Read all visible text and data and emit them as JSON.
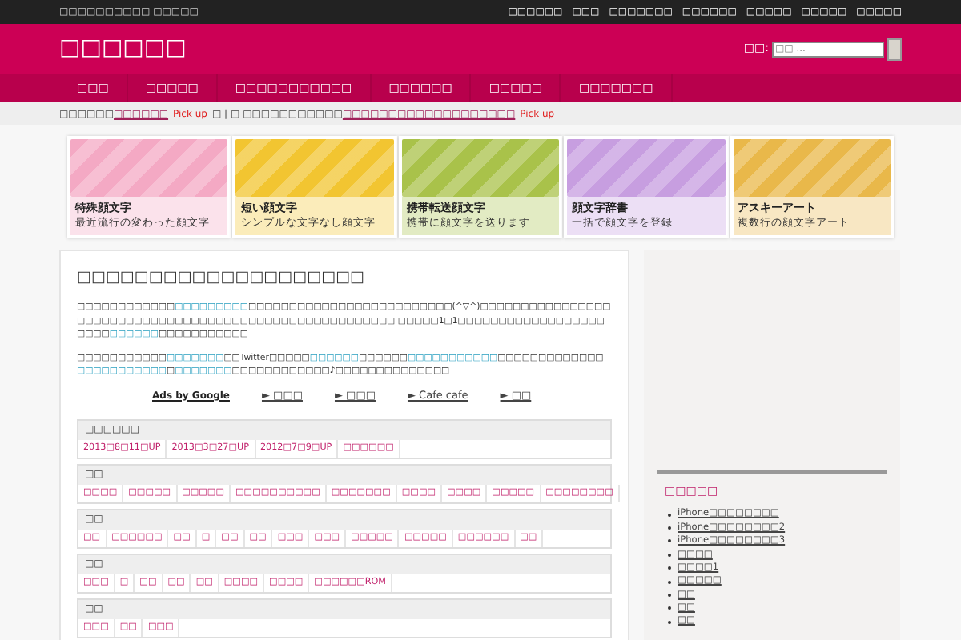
{
  "top_bar": {
    "tagline": "□□□□□□□□□□ □□□□□",
    "links": [
      "□□□□□□",
      "□□□",
      "□□□□□□□",
      "□□□□□□",
      "□□□□□",
      "□□□□□",
      "□□□□□"
    ]
  },
  "header": {
    "title": "□□□□□□",
    "search_label": "□□:",
    "search_placeholder": "□□ ..."
  },
  "nav": [
    "□□□",
    "□□□□□",
    "□□□□□□□□□□□",
    "□□□□□□",
    "□□□□□",
    "□□□□□□□"
  ],
  "pickup": [
    {
      "kind": "plain",
      "text": "□□□□□□"
    },
    {
      "kind": "link",
      "text": "□□□□□□"
    },
    {
      "kind": "pick",
      "text": "Pick up"
    },
    {
      "kind": "plain",
      "text": "□ | □ □□□□□□□□□□□"
    },
    {
      "kind": "link",
      "text": "□□□□□□□□□□□□□□□□□□□"
    },
    {
      "kind": "pick",
      "text": "Pick up"
    }
  ],
  "banners": [
    {
      "title": "特殊顔文字",
      "subtitle": "最近流行の変わった顔文字",
      "color": "#f4a9c4"
    },
    {
      "title": "短い顔文字",
      "subtitle": "シンプルな文字なし顔文字",
      "color": "#f2c531"
    },
    {
      "title": "携帯転送顔文字",
      "subtitle": "携帯に顔文字を送ります",
      "color": "#a9c24a"
    },
    {
      "title": "顔文字辞書",
      "subtitle": "一括で顔文字を登録",
      "color": "#c79ee0"
    },
    {
      "title": "アスキーアート",
      "subtitle": "複数行の顔文字アート",
      "color": "#e9b84a"
    }
  ],
  "article": {
    "title": "□□□□□□□□□□□□□□□□□□□□",
    "paragraphs": [
      [
        {
          "text": "□□□□□□□□□□□□",
          "link": false
        },
        {
          "text": "□□□□□□□□□",
          "link": true
        },
        {
          "text": "□□□□□□□□□□□□□□□□□□□□□□□□□(^▽^)",
          "link": false
        },
        {
          "text": "□□□□□□□□□□□□□□□□□□□□□□□□□□□□□□□□□□□□□□□□□□□□□□□□□□□□□□□ □□□□□1□1□□□□□□□□□□□□□□□□□□□□□□",
          "link": false
        },
        {
          "text": "□□□□□□",
          "link": true
        },
        {
          "text": "□□□□□□□□□□□",
          "link": false
        }
      ],
      [
        {
          "text": "□□□□□□□□□□□",
          "link": false
        },
        {
          "text": "□□□□□□□",
          "link": true
        },
        {
          "text": "□□Twitter□□□□□",
          "link": false
        },
        {
          "text": "□□□□□□",
          "link": true
        },
        {
          "text": "□□□□□□",
          "link": false
        },
        {
          "text": "□□□□□□□□□□□",
          "link": true
        },
        {
          "text": "□□□□□□□□□□□□□ ",
          "link": false
        },
        {
          "text": "□□□□□□□□□□□",
          "link": true
        },
        {
          "text": "□",
          "link": false
        },
        {
          "text": "□□□□□□□",
          "link": true
        },
        {
          "text": "□□□□□□□□□□□□♪□□□□□□□□□□□□□□",
          "link": false
        }
      ]
    ],
    "ads": {
      "label": "Ads by Google",
      "links": [
        "► □□□",
        "► □□□",
        "► Cafe cafe",
        "► □□"
      ]
    },
    "tag_groups": [
      {
        "heading": "□□□□□□",
        "tags": [
          "2013□8□11□UP",
          "2013□3□27□UP",
          "2012□7□9□UP",
          "□□□□□□"
        ]
      },
      {
        "heading": "□□",
        "tags": [
          "□□□□",
          "□□□□□",
          "□□□□□",
          "□□□□□□□□□□",
          "□□□□□□□",
          "□□□□",
          "□□□□",
          "□□□□□",
          "□□□□□□□□"
        ]
      },
      {
        "heading": "□□",
        "tags": [
          "□□",
          "□□□□□□",
          "□□",
          "□",
          "□□",
          "□□",
          "□□□",
          "□□□",
          "□□□□□",
          "□□□□□",
          "□□□□□□",
          "□□"
        ]
      },
      {
        "heading": "□□",
        "tags": [
          "□□□",
          "□",
          "□□",
          "□□",
          "□□",
          "□□□□",
          "□□□□",
          "□□□□□□ROM"
        ]
      },
      {
        "heading": "□□",
        "tags": [
          "□□□",
          "□□",
          "□□□"
        ]
      }
    ]
  },
  "sidebar": {
    "heading": "□□□□□",
    "items": [
      "iPhone□□□□□□□□",
      "iPhone□□□□□□□□2",
      "iPhone□□□□□□□□3",
      "□□□□",
      "□□□□1",
      "□□□□□",
      "□□",
      "□□",
      "□□"
    ]
  }
}
